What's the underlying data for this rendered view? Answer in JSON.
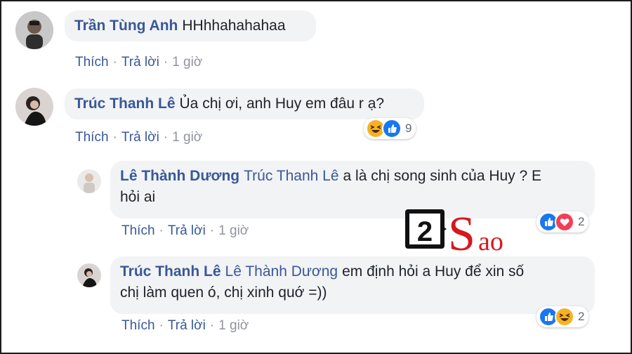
{
  "comments": [
    {
      "name": "Trần Tùng Anh",
      "tag": "",
      "text": "HHhhahahahaa",
      "actions": {
        "like": "Thích",
        "reply": "Trả lời",
        "time": "1 giờ"
      }
    },
    {
      "name": "Trúc Thanh Lê",
      "tag": "",
      "text": "Ủa chị ơi, anh Huy em đâu r ạ?",
      "actions": {
        "like": "Thích",
        "reply": "Trả lời",
        "time": "1 giờ"
      },
      "reactions": {
        "icons": [
          "haha-icon",
          "like-icon"
        ],
        "count": "9"
      }
    },
    {
      "name": "Lê Thành Dương",
      "tag": "Trúc Thanh Lê",
      "text": "a là chị song sinh của Huy ? E",
      "text2": "hỏi ai",
      "actions": {
        "like": "Thích",
        "reply": "Trả lời",
        "time": "1 giờ"
      },
      "reactions": {
        "icons": [
          "like-icon",
          "love-icon"
        ],
        "count": "2"
      }
    },
    {
      "name": "Trúc Thanh Lê",
      "tag": "Lê Thành Dương",
      "text": "em định hỏi a Huy để xin số",
      "text2": "chị làm quen ó, chị xinh quớ =))",
      "actions": {
        "like": "Thích",
        "reply": "Trả lời",
        "time": "1 giờ"
      },
      "reactions": {
        "icons": [
          "like-icon",
          "haha-icon"
        ],
        "count": "2"
      }
    }
  ],
  "watermark": {
    "text": "2Sao"
  },
  "colors": {
    "name": "#385898",
    "bubble": "#f2f3f5",
    "like": "#1877f2",
    "love": "#f33e58",
    "haha": "#f7b125",
    "logo_red": "#d6181e"
  }
}
